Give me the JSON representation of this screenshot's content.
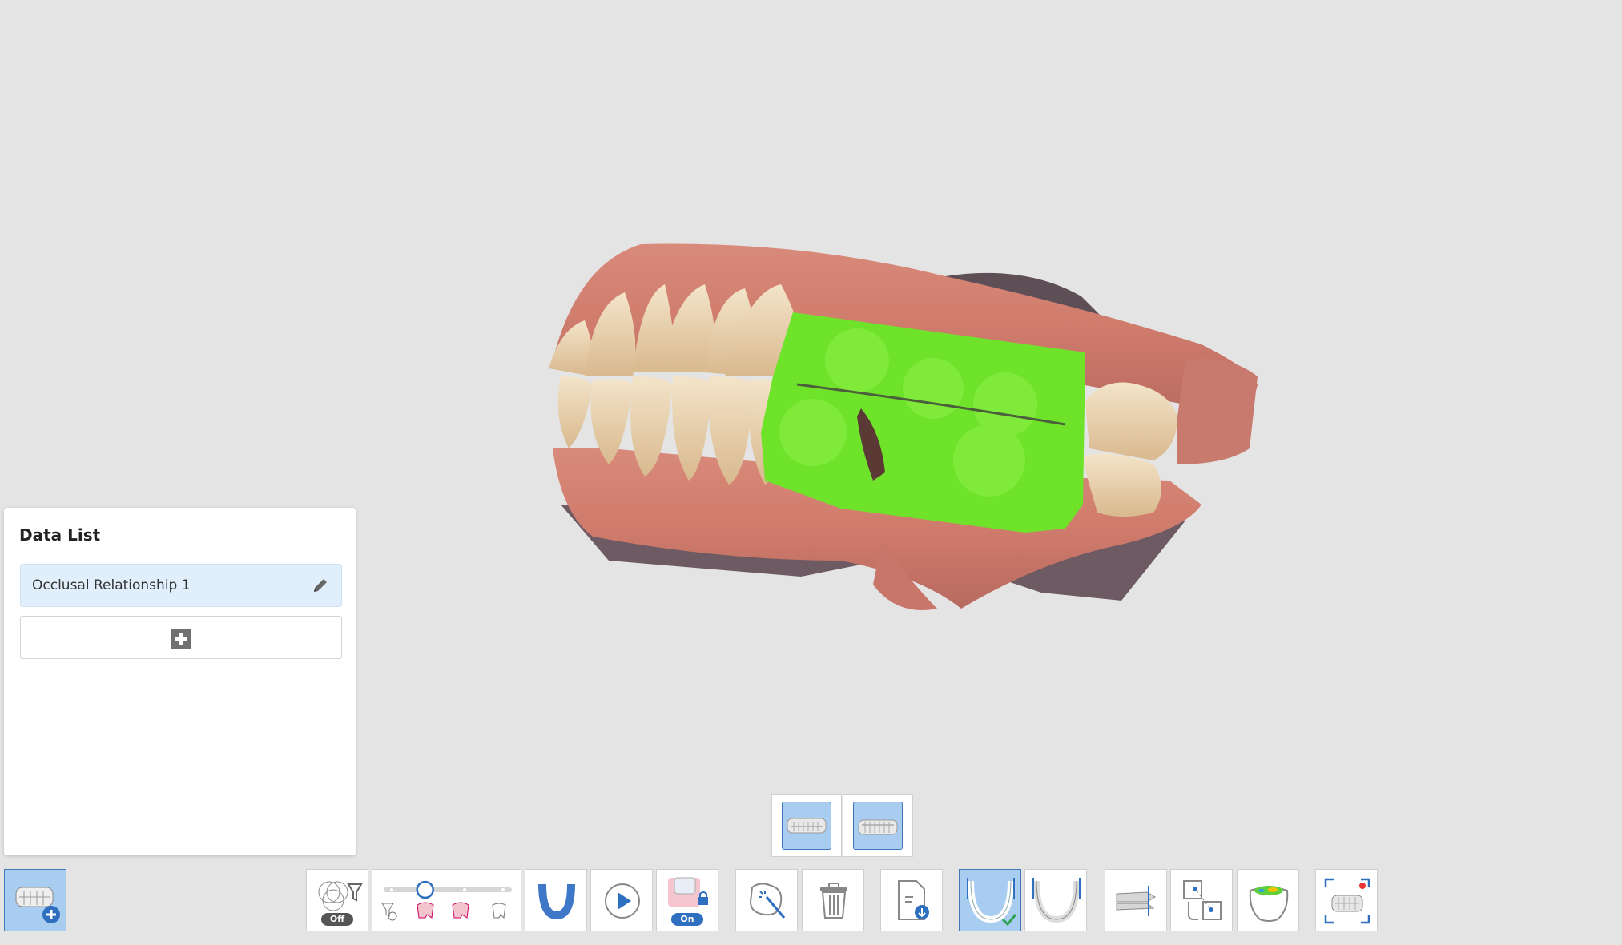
{
  "data_list": {
    "title": "Data List",
    "items": [
      {
        "label": "Occlusal Relationship 1"
      }
    ]
  },
  "toolbar": {
    "filter_toggle_state": "Off",
    "lock_toggle_state": "On",
    "filter_slider_level": 0.3
  },
  "colors": {
    "background": "#e4e4e4",
    "accent": "#3f78b8",
    "active_button": "#a9cdf1",
    "selection_green": "#6fe22a"
  }
}
